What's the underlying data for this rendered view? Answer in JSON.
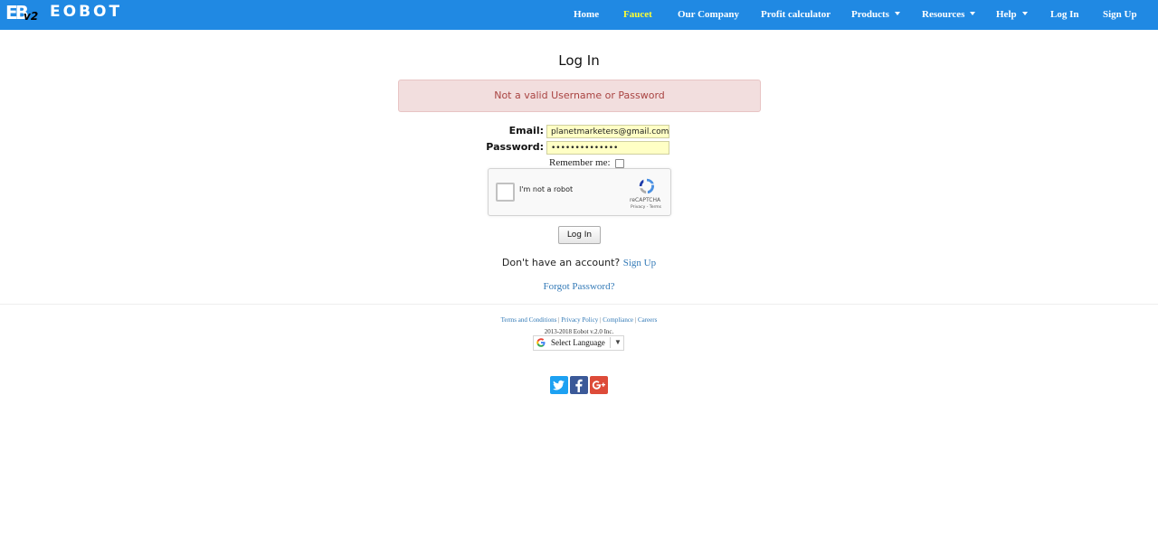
{
  "header": {
    "logo_text": "EOBOT",
    "logo_mark": "EB",
    "logo_version": "v2",
    "nav": [
      {
        "label": "Home"
      },
      {
        "label": "Faucet"
      },
      {
        "label": "Our Company"
      },
      {
        "label": "Profit calculator"
      },
      {
        "label": "Products"
      },
      {
        "label": "Resources"
      },
      {
        "label": "Help"
      },
      {
        "label": "Log In"
      },
      {
        "label": "Sign Up"
      }
    ]
  },
  "login": {
    "title": "Log In",
    "error": "Not a valid Username or Password",
    "email_label": "Email:",
    "email_value": "planetmarketers@gmail.com",
    "password_label": "Password:",
    "password_value": "••••••••••••••",
    "remember_label": "Remember me:",
    "captcha_label": "I'm not a robot",
    "captcha_brand": "reCAPTCHA",
    "captcha_links": "Privacy - Terms",
    "submit_label": "Log In",
    "no_account_text": "Don't have an account?",
    "signup_link": "Sign Up",
    "forgot_link": "Forgot Password?"
  },
  "footer": {
    "links": [
      "Terms and Conditions",
      "Privacy Policy",
      "Compliance",
      "Careers"
    ],
    "separator": "|",
    "copyright": "2013-2018 Eobot v.2.0 Inc.",
    "language_select": "Select Language",
    "social": [
      {
        "name": "twitter-icon",
        "color": "#1da1f2"
      },
      {
        "name": "facebook-icon",
        "color": "#3b5998"
      },
      {
        "name": "google-plus-icon",
        "color": "#dd4b39"
      }
    ]
  },
  "colors": {
    "navbar": "#2089e3",
    "active_nav": "#ffff33",
    "alert_bg": "#f2dede",
    "alert_text": "#a94442",
    "link": "#337ab7",
    "autofill": "#ffffc5"
  }
}
